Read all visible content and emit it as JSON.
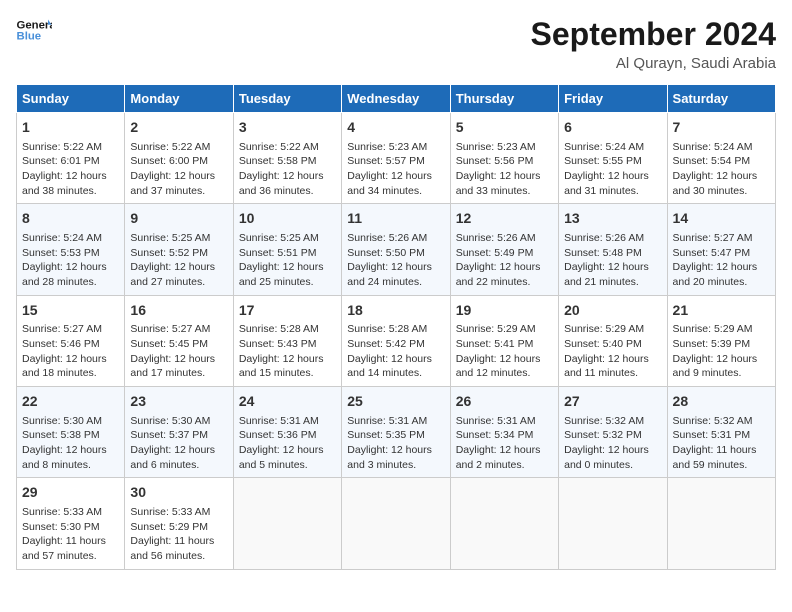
{
  "logo": {
    "line1": "General",
    "line2": "Blue"
  },
  "title": "September 2024",
  "subtitle": "Al Qurayn, Saudi Arabia",
  "days_of_week": [
    "Sunday",
    "Monday",
    "Tuesday",
    "Wednesday",
    "Thursday",
    "Friday",
    "Saturday"
  ],
  "weeks": [
    [
      {
        "day": "1",
        "text": "Sunrise: 5:22 AM\nSunset: 6:01 PM\nDaylight: 12 hours and 38 minutes."
      },
      {
        "day": "2",
        "text": "Sunrise: 5:22 AM\nSunset: 6:00 PM\nDaylight: 12 hours and 37 minutes."
      },
      {
        "day": "3",
        "text": "Sunrise: 5:22 AM\nSunset: 5:58 PM\nDaylight: 12 hours and 36 minutes."
      },
      {
        "day": "4",
        "text": "Sunrise: 5:23 AM\nSunset: 5:57 PM\nDaylight: 12 hours and 34 minutes."
      },
      {
        "day": "5",
        "text": "Sunrise: 5:23 AM\nSunset: 5:56 PM\nDaylight: 12 hours and 33 minutes."
      },
      {
        "day": "6",
        "text": "Sunrise: 5:24 AM\nSunset: 5:55 PM\nDaylight: 12 hours and 31 minutes."
      },
      {
        "day": "7",
        "text": "Sunrise: 5:24 AM\nSunset: 5:54 PM\nDaylight: 12 hours and 30 minutes."
      }
    ],
    [
      {
        "day": "8",
        "text": "Sunrise: 5:24 AM\nSunset: 5:53 PM\nDaylight: 12 hours and 28 minutes."
      },
      {
        "day": "9",
        "text": "Sunrise: 5:25 AM\nSunset: 5:52 PM\nDaylight: 12 hours and 27 minutes."
      },
      {
        "day": "10",
        "text": "Sunrise: 5:25 AM\nSunset: 5:51 PM\nDaylight: 12 hours and 25 minutes."
      },
      {
        "day": "11",
        "text": "Sunrise: 5:26 AM\nSunset: 5:50 PM\nDaylight: 12 hours and 24 minutes."
      },
      {
        "day": "12",
        "text": "Sunrise: 5:26 AM\nSunset: 5:49 PM\nDaylight: 12 hours and 22 minutes."
      },
      {
        "day": "13",
        "text": "Sunrise: 5:26 AM\nSunset: 5:48 PM\nDaylight: 12 hours and 21 minutes."
      },
      {
        "day": "14",
        "text": "Sunrise: 5:27 AM\nSunset: 5:47 PM\nDaylight: 12 hours and 20 minutes."
      }
    ],
    [
      {
        "day": "15",
        "text": "Sunrise: 5:27 AM\nSunset: 5:46 PM\nDaylight: 12 hours and 18 minutes."
      },
      {
        "day": "16",
        "text": "Sunrise: 5:27 AM\nSunset: 5:45 PM\nDaylight: 12 hours and 17 minutes."
      },
      {
        "day": "17",
        "text": "Sunrise: 5:28 AM\nSunset: 5:43 PM\nDaylight: 12 hours and 15 minutes."
      },
      {
        "day": "18",
        "text": "Sunrise: 5:28 AM\nSunset: 5:42 PM\nDaylight: 12 hours and 14 minutes."
      },
      {
        "day": "19",
        "text": "Sunrise: 5:29 AM\nSunset: 5:41 PM\nDaylight: 12 hours and 12 minutes."
      },
      {
        "day": "20",
        "text": "Sunrise: 5:29 AM\nSunset: 5:40 PM\nDaylight: 12 hours and 11 minutes."
      },
      {
        "day": "21",
        "text": "Sunrise: 5:29 AM\nSunset: 5:39 PM\nDaylight: 12 hours and 9 minutes."
      }
    ],
    [
      {
        "day": "22",
        "text": "Sunrise: 5:30 AM\nSunset: 5:38 PM\nDaylight: 12 hours and 8 minutes."
      },
      {
        "day": "23",
        "text": "Sunrise: 5:30 AM\nSunset: 5:37 PM\nDaylight: 12 hours and 6 minutes."
      },
      {
        "day": "24",
        "text": "Sunrise: 5:31 AM\nSunset: 5:36 PM\nDaylight: 12 hours and 5 minutes."
      },
      {
        "day": "25",
        "text": "Sunrise: 5:31 AM\nSunset: 5:35 PM\nDaylight: 12 hours and 3 minutes."
      },
      {
        "day": "26",
        "text": "Sunrise: 5:31 AM\nSunset: 5:34 PM\nDaylight: 12 hours and 2 minutes."
      },
      {
        "day": "27",
        "text": "Sunrise: 5:32 AM\nSunset: 5:32 PM\nDaylight: 12 hours and 0 minutes."
      },
      {
        "day": "28",
        "text": "Sunrise: 5:32 AM\nSunset: 5:31 PM\nDaylight: 11 hours and 59 minutes."
      }
    ],
    [
      {
        "day": "29",
        "text": "Sunrise: 5:33 AM\nSunset: 5:30 PM\nDaylight: 11 hours and 57 minutes."
      },
      {
        "day": "30",
        "text": "Sunrise: 5:33 AM\nSunset: 5:29 PM\nDaylight: 11 hours and 56 minutes."
      },
      {
        "day": "",
        "text": ""
      },
      {
        "day": "",
        "text": ""
      },
      {
        "day": "",
        "text": ""
      },
      {
        "day": "",
        "text": ""
      },
      {
        "day": "",
        "text": ""
      }
    ]
  ]
}
